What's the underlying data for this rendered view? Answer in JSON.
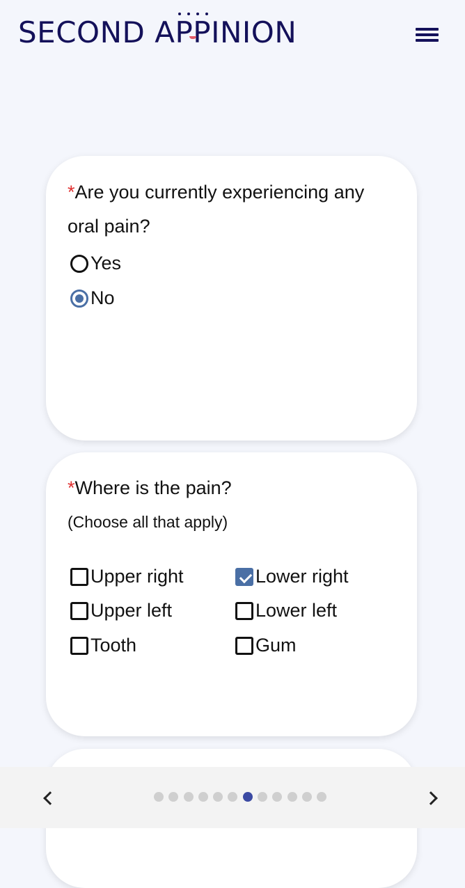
{
  "header": {
    "logo_text_start": "SECOND A",
    "logo_text_pp": "PP",
    "logo_text_end": "INION",
    "menu_icon": "hamburger-menu-icon"
  },
  "q1": {
    "required_mark": "*",
    "question": "Are you currently experiencing any oral pain?",
    "options": [
      {
        "label": "Yes",
        "selected": false
      },
      {
        "label": "No",
        "selected": true
      }
    ]
  },
  "q2": {
    "required_mark": "*",
    "question": "Where is the pain?",
    "hint": "(Choose all that apply)",
    "options": [
      {
        "label": "Upper right",
        "checked": false
      },
      {
        "label": "Lower right",
        "checked": true
      },
      {
        "label": "Upper left",
        "checked": false
      },
      {
        "label": "Lower left",
        "checked": false
      },
      {
        "label": "Tooth",
        "checked": false
      },
      {
        "label": "Gum",
        "checked": false
      }
    ]
  },
  "pager": {
    "prev_icon": "chevron-left-icon",
    "next_icon": "chevron-right-icon",
    "total_pages": 12,
    "current_page": 7
  },
  "colors": {
    "brand": "#14115a",
    "accent": "#4a6fa5",
    "active_dot": "#3b4aa3",
    "required": "#e03131"
  }
}
